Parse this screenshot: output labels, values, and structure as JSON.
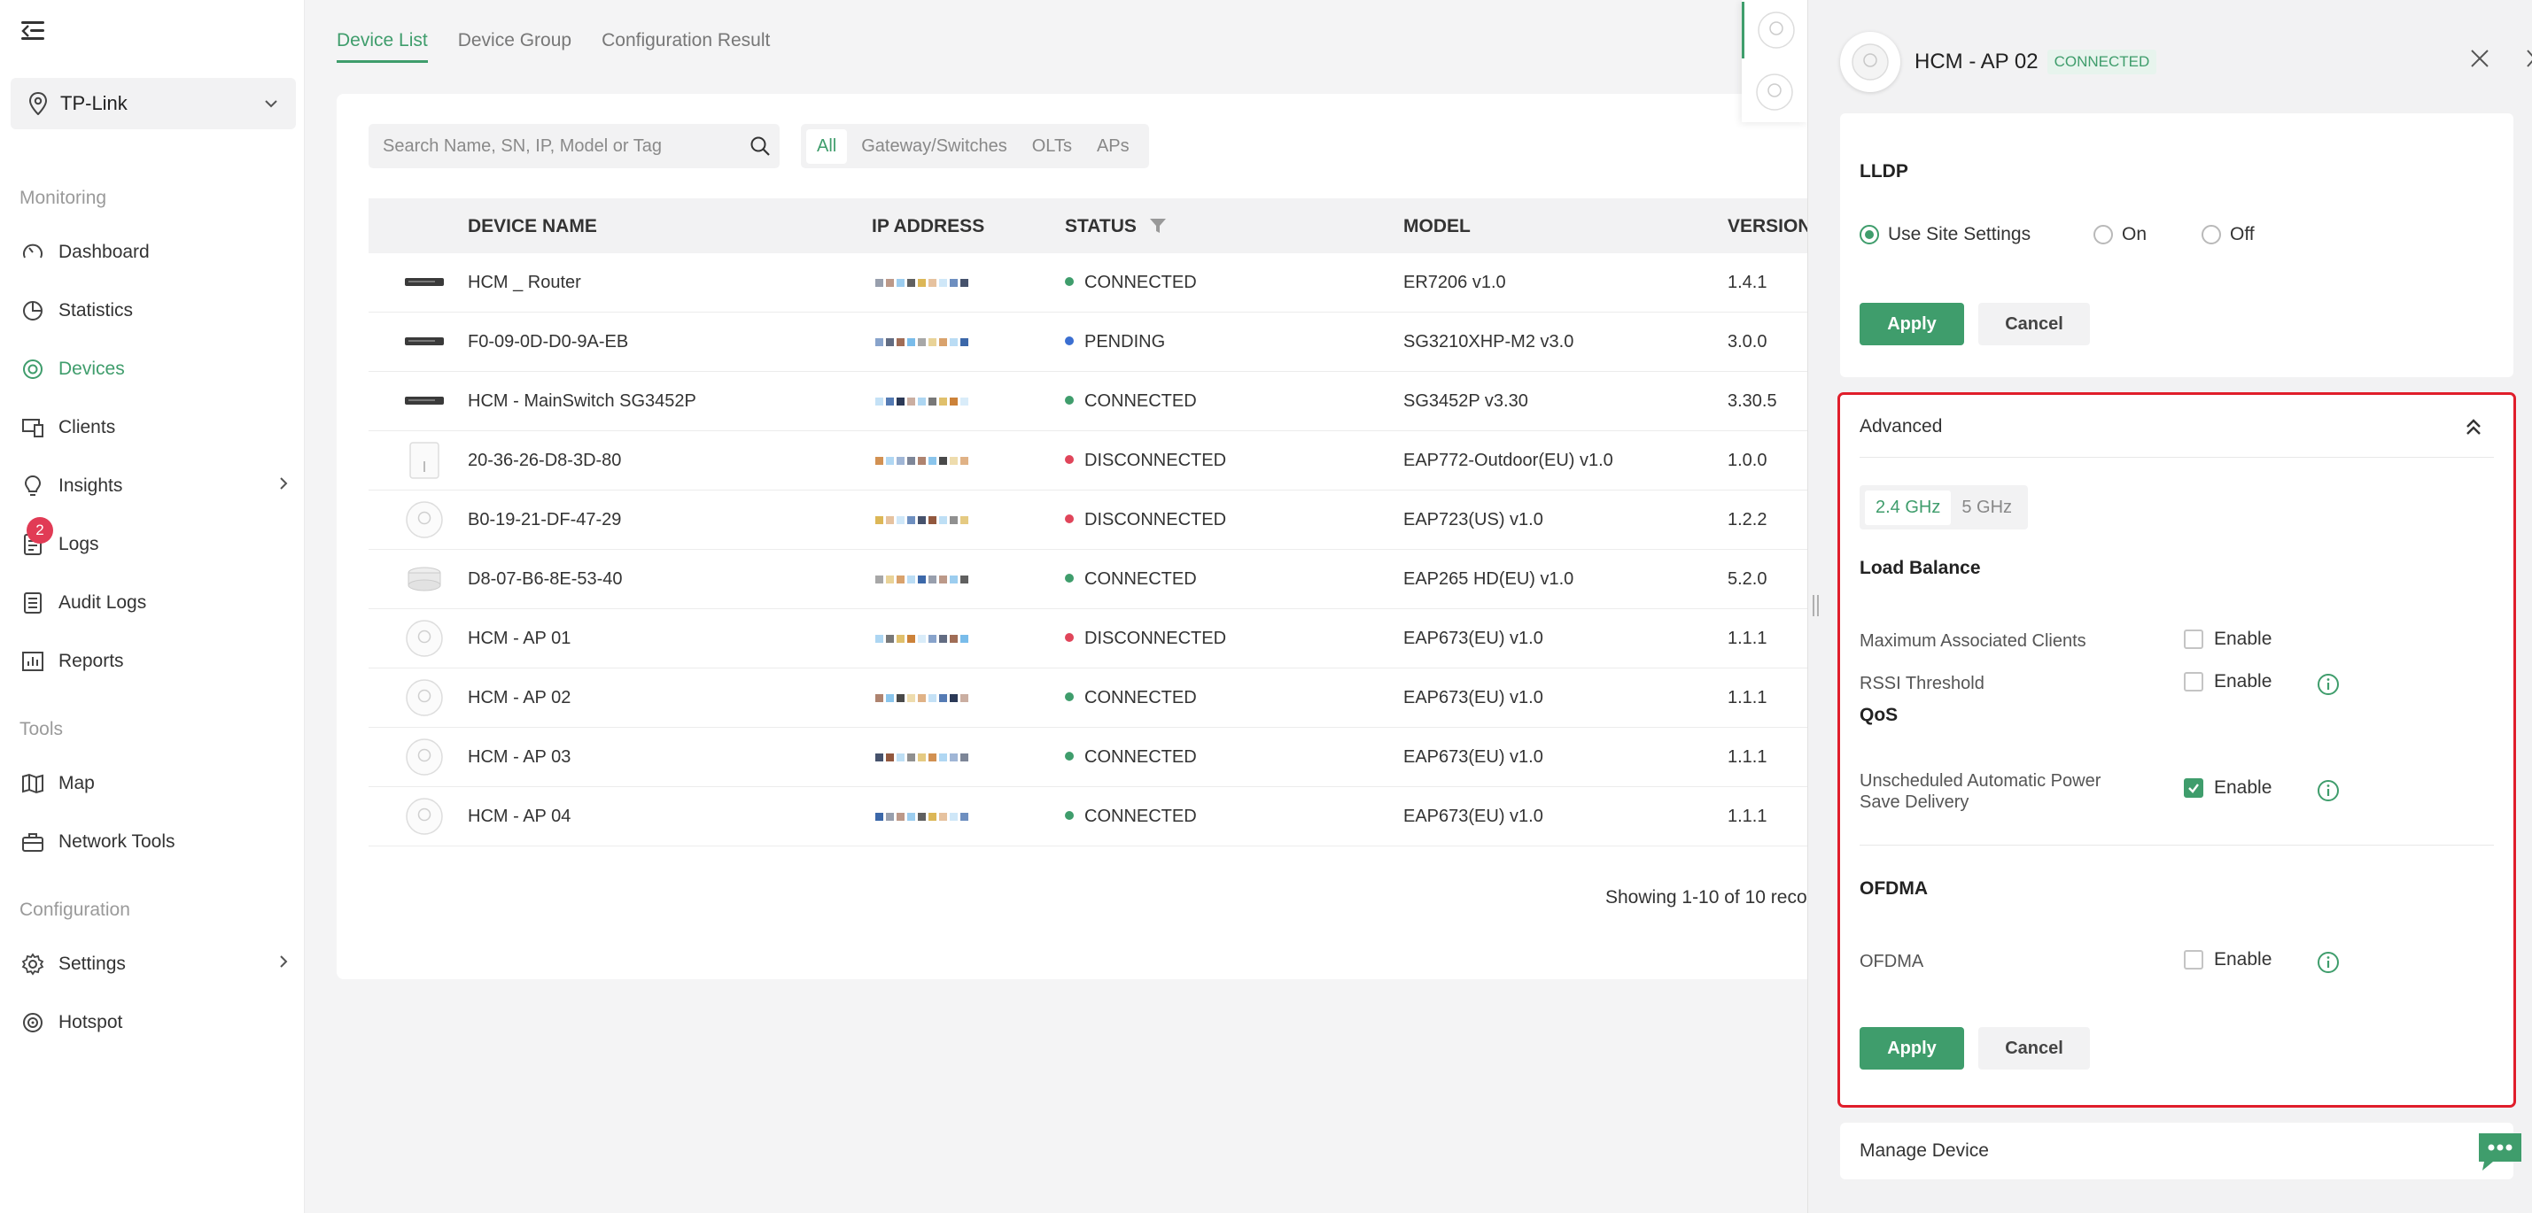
{
  "sidebar": {
    "site": "TP-Link",
    "sections": {
      "monitoring": "Monitoring",
      "tools": "Tools",
      "configuration": "Configuration"
    },
    "items": {
      "dashboard": "Dashboard",
      "statistics": "Statistics",
      "devices": "Devices",
      "clients": "Clients",
      "insights": "Insights",
      "logs": "Logs",
      "logs_badge": "2",
      "audit_logs": "Audit Logs",
      "reports": "Reports",
      "map": "Map",
      "network_tools": "Network Tools",
      "settings": "Settings",
      "hotspot": "Hotspot"
    }
  },
  "tabs": {
    "device_list": "Device List",
    "device_group": "Device Group",
    "configuration_result": "Configuration Result"
  },
  "search": {
    "placeholder": "Search Name, SN, IP, Model or Tag",
    "value": ""
  },
  "filters": {
    "all": "All",
    "gateway": "Gateway/Switches",
    "olts": "OLTs",
    "aps": "APs"
  },
  "table": {
    "headers": {
      "name": "DEVICE NAME",
      "ip": "IP ADDRESS",
      "status": "STATUS",
      "model": "MODEL",
      "version": "VERSION"
    },
    "rows": [
      {
        "name": "HCM _ Router",
        "status": "CONNECTED",
        "model": "ER7206 v1.0",
        "version": "1.4.1"
      },
      {
        "name": "F0-09-0D-D0-9A-EB",
        "status": "PENDING",
        "model": "SG3210XHP-M2 v3.0",
        "version": "3.0.0"
      },
      {
        "name": "HCM - MainSwitch SG3452P",
        "status": "CONNECTED",
        "model": "SG3452P v3.30",
        "version": "3.30.5"
      },
      {
        "name": "20-36-26-D8-3D-80",
        "status": "DISCONNECTED",
        "model": "EAP772-Outdoor(EU) v1.0",
        "version": "1.0.0"
      },
      {
        "name": "B0-19-21-DF-47-29",
        "status": "DISCONNECTED",
        "model": "EAP723(US) v1.0",
        "version": "1.2.2"
      },
      {
        "name": "D8-07-B6-8E-53-40",
        "status": "CONNECTED",
        "model": "EAP265 HD(EU) v1.0",
        "version": "5.2.0"
      },
      {
        "name": "HCM - AP 01",
        "status": "DISCONNECTED",
        "model": "EAP673(EU) v1.0",
        "version": "1.1.1"
      },
      {
        "name": "HCM - AP 02",
        "status": "CONNECTED",
        "model": "EAP673(EU) v1.0",
        "version": "1.1.1"
      },
      {
        "name": "HCM - AP 03",
        "status": "CONNECTED",
        "model": "EAP673(EU) v1.0",
        "version": "1.1.1"
      },
      {
        "name": "HCM - AP 04",
        "status": "CONNECTED",
        "model": "EAP673(EU) v1.0",
        "version": "1.1.1"
      }
    ],
    "pager": "Showing 1-10 of 10 reco"
  },
  "status_colors": {
    "CONNECTED": "#3f9d6c",
    "PENDING": "#3b6fd1",
    "DISCONNECTED": "#e0455a"
  },
  "drawer": {
    "title": "HCM - AP 02",
    "badge": "CONNECTED",
    "lldp": {
      "title": "LLDP",
      "options": {
        "site": "Use Site Settings",
        "on": "On",
        "off": "Off"
      },
      "selected": "site",
      "apply": "Apply",
      "cancel": "Cancel"
    },
    "advanced": {
      "title": "Advanced",
      "bands": {
        "b24": "2.4 GHz",
        "b5": "5 GHz"
      },
      "load_balance": "Load Balance",
      "max_clients": "Maximum Associated Clients",
      "rssi": "RSSI Threshold",
      "qos": "QoS",
      "uapsd": "Unscheduled Automatic Power Save Delivery",
      "ofdma_title": "OFDMA",
      "ofdma": "OFDMA",
      "enable": "Enable",
      "apply": "Apply",
      "cancel": "Cancel"
    },
    "manage": "Manage Device"
  }
}
